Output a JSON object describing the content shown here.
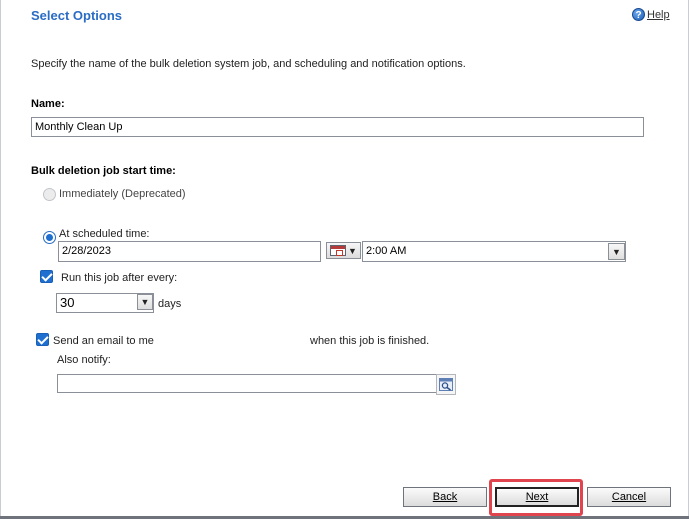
{
  "header": {
    "title": "Select Options",
    "help_label": "Help"
  },
  "description": "Specify the name of the bulk deletion system job, and scheduling and notification options.",
  "name_section": {
    "label": "Name:",
    "value": "Monthly Clean Up"
  },
  "start_time": {
    "label": "Bulk deletion job start time:",
    "immediately_label": "Immediately (Deprecated)",
    "scheduled_label": "At scheduled time:",
    "date_value": "2/28/2023",
    "time_value": "2:00 AM"
  },
  "recurrence": {
    "label": "Run this job after every:",
    "value": "30",
    "unit": "days"
  },
  "email": {
    "label": "Send an email to me",
    "suffix": "when this job is finished.",
    "also_notify_label": "Also notify:",
    "also_notify_value": ""
  },
  "footer": {
    "back_label": "Back",
    "next_label": "Next",
    "cancel_label": "Cancel"
  },
  "colors": {
    "title": "#2b6cc4",
    "checkbox": "#1f6fd1",
    "highlight": "#e0454f"
  }
}
